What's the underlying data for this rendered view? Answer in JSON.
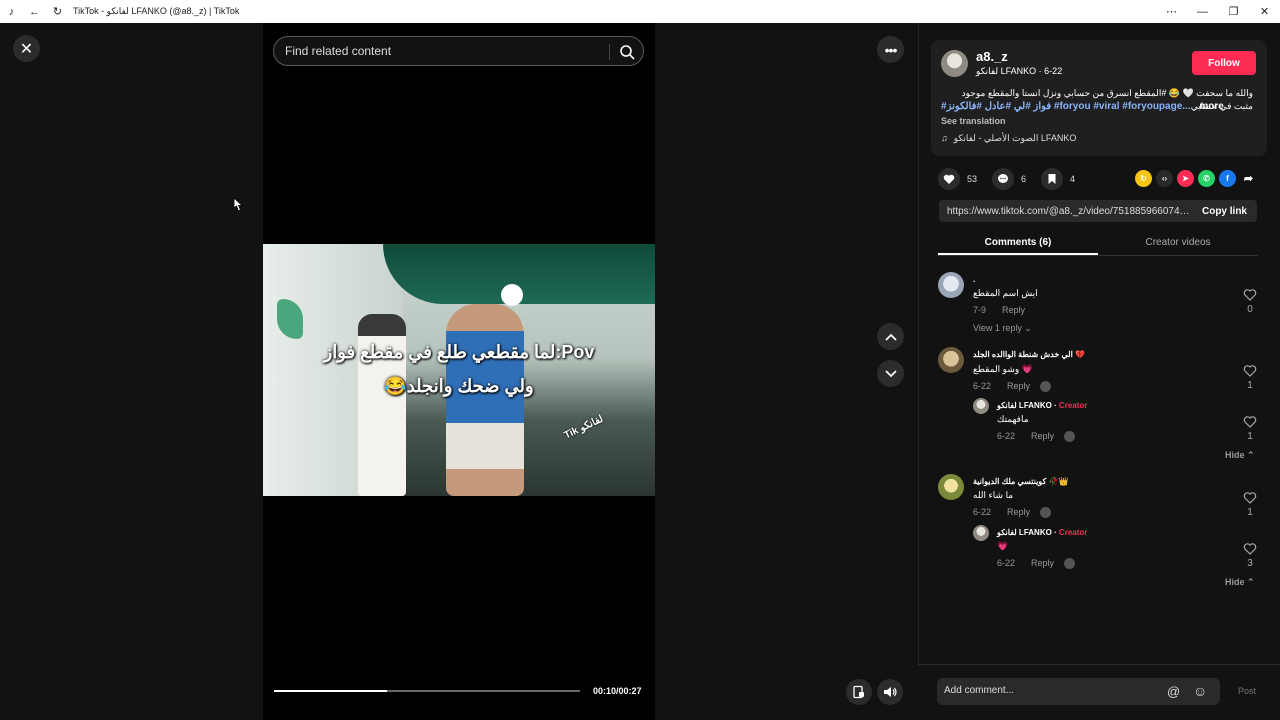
{
  "window": {
    "title": "TikTok - لفانكو LFANKO (@a8._z) | TikTok"
  },
  "player": {
    "search_placeholder": "Find related content",
    "caption_line1": "لما مقطعي طلع في مقطع فواز:Pov",
    "caption_line2": "😂ولي ضحك وانجلد",
    "watermark": "Tik لفانكو",
    "time": "00:10/00:27",
    "progress": 0.37
  },
  "author": {
    "handle": "a8._z",
    "display": "لفانكو LFANKO · 6-22",
    "follow_label": "Follow",
    "description": "والله ما سحفت 🤍 😂 #المقطع انسرق من حسابي ونزل انستا والمقطع موجود مثبت في حسابي",
    "hashtags": "#فواز #لي #عادل #فالكونز #foryou #viral #foryoupage...",
    "more_label": "more",
    "see_translation": "See translation",
    "music": "الصوت الأصلي - لفانكو LFANKO"
  },
  "stats": {
    "likes": "53",
    "comments": "6",
    "saves": "4"
  },
  "share": {
    "url": "https://www.tiktok.com/@a8._z/video/7518859660741...",
    "copy_label": "Copy link",
    "colors": [
      "#f5c518",
      "#2a2a2a",
      "#fe2c55",
      "#25d366",
      "#1877f2"
    ]
  },
  "tabs": {
    "comments": "Comments (6)",
    "creator_videos": "Creator videos"
  },
  "comments": [
    {
      "name": ".",
      "text": "ايش اسم المقطع",
      "date": "7-9",
      "reply": "Reply",
      "likes": "0",
      "view_replies": "View 1 reply"
    },
    {
      "name": "الي خدش شنطة الواالده الجلد 💔",
      "text": "وشو المقطع 💗",
      "date": "6-22",
      "reply": "Reply",
      "likes": "1",
      "replies": [
        {
          "name": "لفانكو LFANKO",
          "badge": "Creator",
          "text": "مافهمتك",
          "date": "6-22",
          "reply": "Reply",
          "likes": "1"
        }
      ],
      "hide": "Hide"
    },
    {
      "name": "كوينتسي ملك الديوانية 🥀👑",
      "text": "ما شاء الله",
      "date": "6-22",
      "reply": "Reply",
      "likes": "1",
      "replies": [
        {
          "name": "لفانكو LFANKO",
          "badge": "Creator",
          "text": "💗",
          "date": "6-22",
          "reply": "Reply",
          "likes": "3"
        }
      ],
      "hide": "Hide"
    }
  ],
  "composer": {
    "placeholder": "Add comment...",
    "post_label": "Post"
  }
}
